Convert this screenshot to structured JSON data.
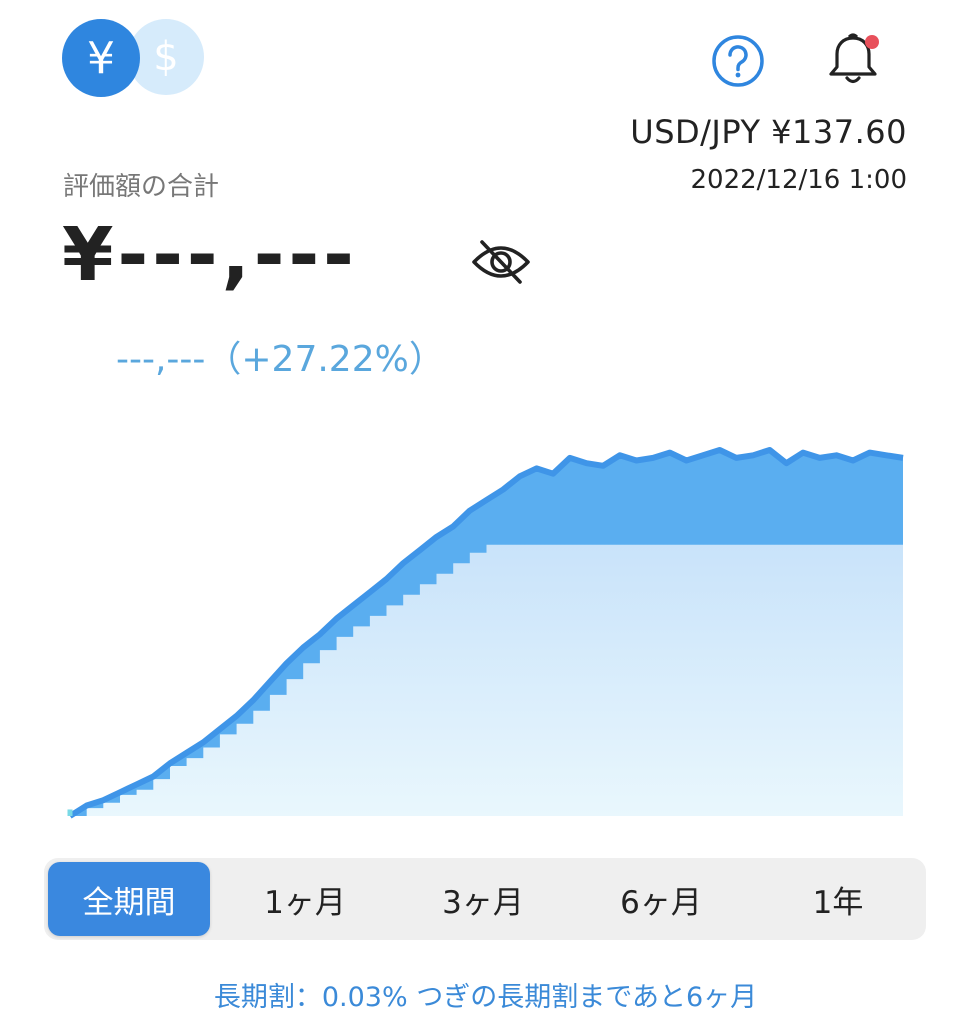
{
  "header": {
    "currency_jpy_symbol": "¥",
    "currency_usd_symbol": "$",
    "help_icon": "help-circle-icon",
    "bell_icon": "bell-icon",
    "notification_dot_color": "#e8505b"
  },
  "rate": {
    "text": "USD/JPY  ¥137.60",
    "datetime": "2022/12/16 1:00"
  },
  "summary": {
    "label": "評価額の合計",
    "value": "¥---,---",
    "gain": "---,---（+27.22%）"
  },
  "periods": [
    {
      "label": "全期間",
      "active": true
    },
    {
      "label": "1ヶ月",
      "active": false
    },
    {
      "label": "3ヶ月",
      "active": false
    },
    {
      "label": "6ヶ月",
      "active": false
    },
    {
      "label": "1年",
      "active": false
    }
  ],
  "footer": {
    "longterm": "長期割：0.03%  つぎの長期割まであと6ヶ月"
  },
  "colors": {
    "accent": "#3a88df",
    "valuation_fill": "#5aaef0",
    "valuation_line": "#3f95e8",
    "principal_top": "#c9e3fa",
    "principal_bottom": "#e9f7fd",
    "start_line": "#79d9e6"
  },
  "chart_data": {
    "type": "area",
    "x": [
      0,
      3,
      6,
      9,
      12,
      15,
      18,
      21,
      24,
      27,
      30,
      33,
      36,
      39,
      42,
      45,
      48,
      51,
      54,
      57,
      60,
      63,
      66,
      69,
      72,
      75,
      78,
      81,
      84,
      87,
      90,
      93,
      96,
      99,
      102,
      105,
      108,
      111,
      114,
      117,
      120,
      123,
      126,
      129,
      132,
      135,
      138,
      141,
      144,
      147,
      150
    ],
    "series": [
      {
        "values": [
          0,
          3,
          5,
          8,
          10,
          14,
          19,
          22,
          26,
          31,
          35,
          40,
          46,
          52,
          58,
          63,
          68,
          72,
          76,
          80,
          84,
          88,
          92,
          96,
          100,
          103,
          103,
          103,
          103,
          103,
          103,
          103,
          103,
          103,
          103,
          103,
          103,
          103,
          103,
          103,
          103,
          103,
          103,
          103,
          103,
          103,
          103,
          103,
          103,
          103,
          103
        ]
      },
      {
        "values": [
          0,
          4,
          6,
          9,
          12,
          15,
          20,
          24,
          28,
          33,
          38,
          44,
          51,
          58,
          64,
          69,
          75,
          80,
          85,
          90,
          96,
          101,
          106,
          110,
          116,
          120,
          124,
          129,
          132,
          130,
          136,
          134,
          133,
          137,
          135,
          136,
          138,
          135,
          137,
          139,
          136,
          137,
          139,
          134,
          138,
          136,
          137,
          135,
          138,
          137,
          136
        ]
      }
    ]
  }
}
